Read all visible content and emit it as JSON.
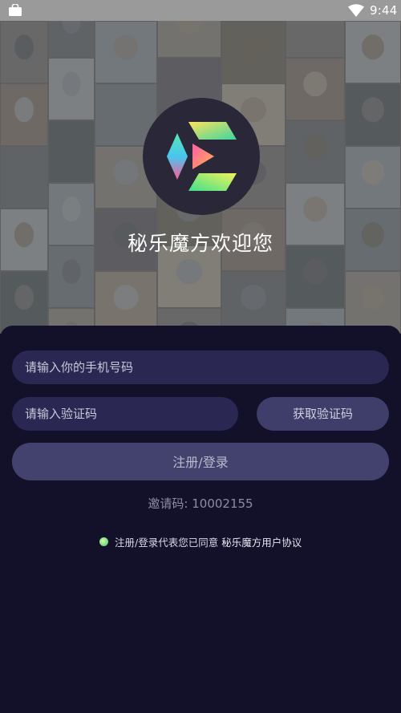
{
  "status_bar": {
    "time": "9:44"
  },
  "welcome": {
    "title": "秘乐魔方欢迎您"
  },
  "form": {
    "phone_placeholder": "请输入你的手机号码",
    "code_placeholder": "请输入验证码",
    "get_code_label": "获取验证码",
    "login_label": "注册/登录",
    "invite_code_text": "邀请码: 10002155"
  },
  "agreement": {
    "text": "注册/登录代表您已同意",
    "link": "秘乐魔方用户协议"
  },
  "colors": {
    "panel_bg": "#121129",
    "field_bg": "#2a2853",
    "button_bg": "#43426f",
    "status_bar": "#9a9a9a"
  }
}
